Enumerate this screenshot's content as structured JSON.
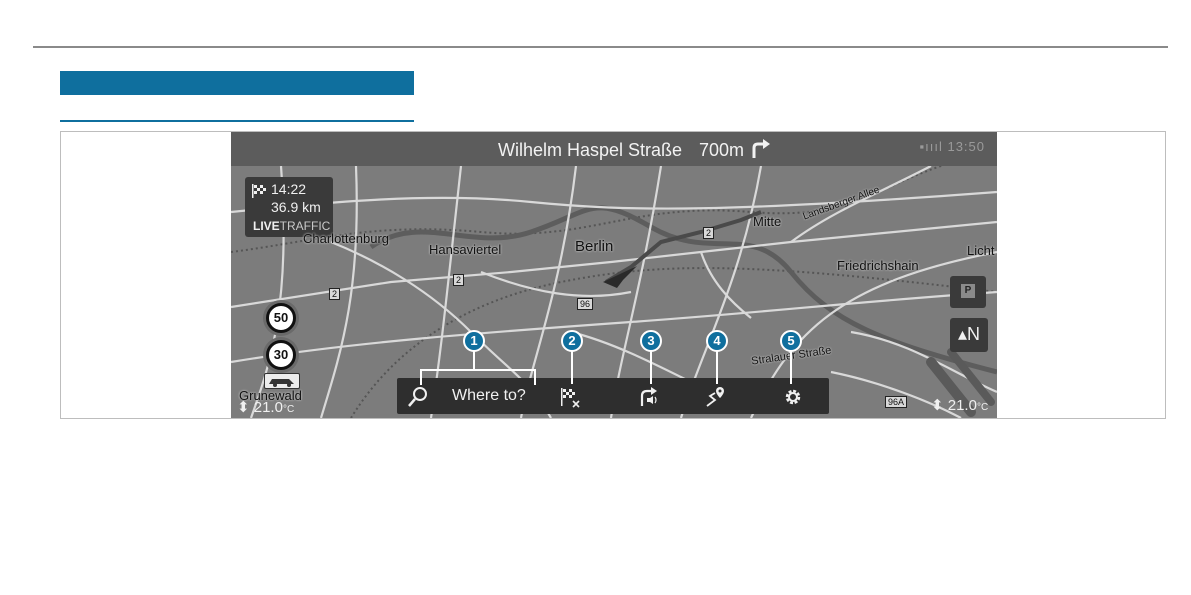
{
  "header": {
    "street": "Wilhelm Haspel Straße",
    "distance": "700m",
    "status": "▪ıııl 13:50"
  },
  "eta_panel": {
    "time": "14:22",
    "distance": "36.9 km",
    "live": "LIVE",
    "traffic": "TRAFFIC"
  },
  "map_labels": {
    "charlottenburg": "Charlottenburg",
    "hansaviertel": "Hansaviertel",
    "berlin": "Berlin",
    "mitte": "Mitte",
    "landsberger_allee": "Landsberger Allee",
    "friedrichshain": "Friedrichshain",
    "licht": "Licht",
    "grunewald": "Grunewald",
    "stralauer": "Stralauer Straße"
  },
  "road_signs": {
    "r2a": "2",
    "r2b": "2",
    "r2c": "2",
    "r96": "96",
    "r96a": "96A"
  },
  "speed_limits": [
    "50",
    "30"
  ],
  "temperature": {
    "left": "21.0",
    "right": "21.0",
    "unit": "°C"
  },
  "map_buttons": {
    "parking": "P",
    "north": "N"
  },
  "menu": {
    "search_placeholder": "Where to?"
  },
  "callouts": [
    "1",
    "2",
    "3",
    "4",
    "5"
  ],
  "icons": [
    "destination-flag-icon",
    "turn-right-icon",
    "search-icon",
    "cancel-route-icon",
    "voice-guidance-icon",
    "route-destination-icon",
    "settings-gear-icon",
    "car-icon"
  ]
}
